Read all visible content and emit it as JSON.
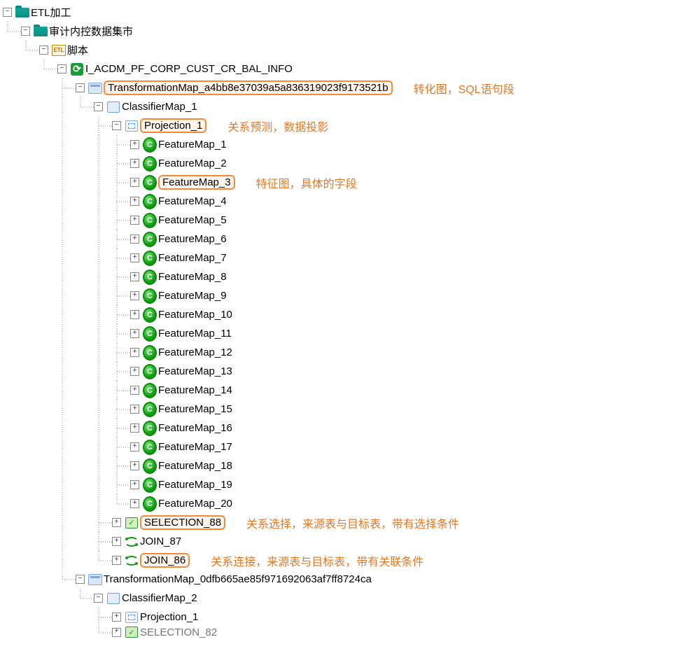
{
  "tree": {
    "root": {
      "label": "ETL加工",
      "children": {
        "dm": {
          "label": "审计内控数据集市",
          "children": {
            "scripts": {
              "label": "脚本",
              "children": {
                "job": {
                  "label": "I_ACDM_PF_CORP_CUST_CR_BAL_INFO",
                  "transformationMaps": [
                    {
                      "label": "TransformationMap_a4bb8e37039a5a836319023f9173521b",
                      "highlight": true,
                      "annotation": "转化图，SQL语句段",
                      "classifiers": [
                        {
                          "label": "ClassifierMap_1",
                          "children": [
                            {
                              "kind": "projection",
                              "label": "Projection_1",
                              "highlight": true,
                              "annotation": "关系预测，数据投影",
                              "features": [
                                "FeatureMap_1",
                                "FeatureMap_2",
                                "FeatureMap_3",
                                "FeatureMap_4",
                                "FeatureMap_5",
                                "FeatureMap_6",
                                "FeatureMap_7",
                                "FeatureMap_8",
                                "FeatureMap_9",
                                "FeatureMap_10",
                                "FeatureMap_11",
                                "FeatureMap_12",
                                "FeatureMap_13",
                                "FeatureMap_14",
                                "FeatureMap_15",
                                "FeatureMap_16",
                                "FeatureMap_17",
                                "FeatureMap_18",
                                "FeatureMap_19",
                                "FeatureMap_20"
                              ],
                              "feature_highlight_index": 2,
                              "feature_annotation": "特征图，具体的字段"
                            },
                            {
                              "kind": "selection",
                              "label": "SELECTION_88",
                              "highlight": true,
                              "annotation": "关系选择，来源表与目标表，带有选择条件"
                            },
                            {
                              "kind": "join",
                              "label": "JOIN_87"
                            },
                            {
                              "kind": "join",
                              "label": "JOIN_86",
                              "highlight": true,
                              "annotation": "关系连接，来源表与目标表，带有关联条件"
                            }
                          ]
                        }
                      ]
                    },
                    {
                      "label": "TransformationMap_0dfb665ae85f971692063af7ff8724ca",
                      "classifiers": [
                        {
                          "label": "ClassifierMap_2",
                          "children": [
                            {
                              "kind": "projection",
                              "label": "Projection_1"
                            },
                            {
                              "kind": "selection",
                              "label": "SELECTION_82",
                              "truncated": true
                            }
                          ]
                        }
                      ]
                    }
                  ]
                }
              }
            }
          }
        }
      }
    }
  }
}
